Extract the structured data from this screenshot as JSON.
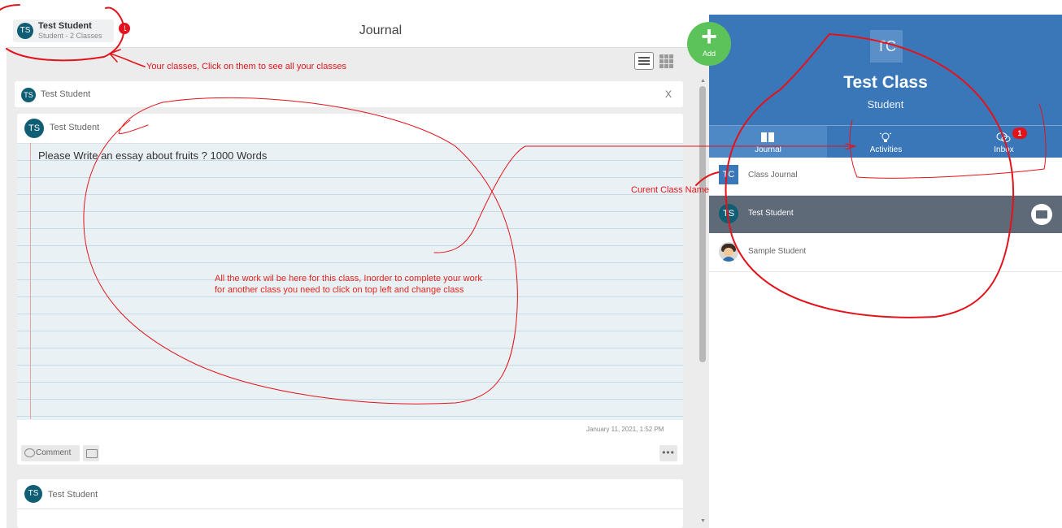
{
  "header": {
    "user_chip": {
      "avatar": "TS",
      "name": "Test Student",
      "subtitle": "Student - 2 Classes",
      "badge": "1"
    },
    "title": "Journal"
  },
  "add_button": {
    "icon": "plus-icon",
    "label": "Add",
    "color": "#5cc35a"
  },
  "feed": {
    "view_toggle": {
      "list": "list-view-icon",
      "grid": "grid-view-icon"
    },
    "filter_card": {
      "avatar": "TS",
      "name": "Test Student",
      "close": "X"
    },
    "post": {
      "avatar": "TS",
      "name": "Test Student",
      "text": "Please Write an essay about fruits ? 1000 Words",
      "date": "January 11, 2021, 1:52 PM",
      "comment_label": "Comment",
      "more": "•••"
    },
    "post2": {
      "avatar": "TS",
      "name": "Test Student"
    }
  },
  "class_panel": {
    "avatar": "TC",
    "name": "Test Class",
    "role": "Student",
    "accent": "#3a77b8",
    "tabs": [
      {
        "label": "Journal",
        "icon": "book-icon",
        "active": true
      },
      {
        "label": "Activities",
        "icon": "lightbulb-icon"
      },
      {
        "label": "Inbox",
        "icon": "chat-bubbles-icon",
        "badge": "1"
      }
    ],
    "rows": [
      {
        "avatar": "TC",
        "label": "Class Journal"
      },
      {
        "avatar": "TS",
        "label": "Test Student",
        "selected": true
      },
      {
        "avatar": "student-photo",
        "label": "Sample Student"
      }
    ]
  },
  "annotations": {
    "classes_hint": "Your classes, Click on them to see all your classes",
    "class_name_hint": "Curent Class Name",
    "work_hint": "All the work wil be here for this class, Inorder to complete your work for another class you need to click on top left and change class"
  }
}
